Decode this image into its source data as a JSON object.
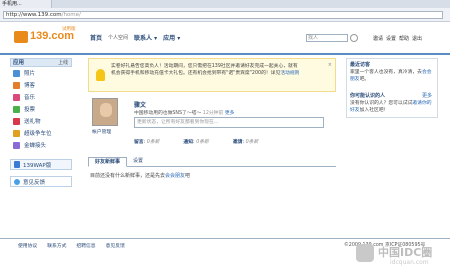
{
  "browser": {
    "tab_title": "手机用...",
    "url_host": "http://www.139.com",
    "url_path": "/home/"
  },
  "header": {
    "logo_text": "139.com",
    "trial_badge": "试用版",
    "nav": [
      {
        "label": "首页"
      },
      {
        "label": "个人空间"
      },
      {
        "label": "联系人 ▾"
      },
      {
        "label": "应用 ▾"
      }
    ],
    "search_placeholder": "找人",
    "top_links": [
      "邀请",
      "设置",
      "帮助",
      "退出"
    ]
  },
  "sidebar": {
    "title": "应用",
    "action": "上线",
    "items": [
      {
        "label": "照片",
        "icon": "photo-icon",
        "color": "#4a90d9"
      },
      {
        "label": "博客",
        "icon": "blog-icon",
        "color": "#e27d2b"
      },
      {
        "label": "音乐",
        "icon": "music-icon",
        "color": "#d94a7a"
      },
      {
        "label": "投票",
        "icon": "vote-icon",
        "color": "#4ab04a"
      },
      {
        "label": "送礼物",
        "icon": "gift-icon",
        "color": "#d9374a"
      },
      {
        "label": "超级争车位",
        "icon": "parking-icon",
        "color": "#e0a020"
      },
      {
        "label": "金蝉接头",
        "icon": "game-icon",
        "color": "#8a6ad9"
      }
    ],
    "wap_label": "139WAP版",
    "feedback_label": "意见反馈"
  },
  "notice": {
    "line1": "实卷好礼悬告您高负人！活动期间，您只需把在139社区并邀请好友完成一起关心，就有",
    "line2": "机会获得手机和移动充值卡大礼包。还有机会抢到带有\"诺\"贵宾席\"200的！详见",
    "link": "活动规则",
    "close": "×"
  },
  "profile": {
    "name": "骤文",
    "caption": "帐户管理",
    "meta_a": "中国移动用的也做SNS了～嗒～",
    "meta_b": "12分钟前",
    "meta_more": "更多",
    "status_placeholder": "更新状态，让所有好友都看到你现在...",
    "counters": [
      {
        "label": "留言",
        "value": "0条新"
      },
      {
        "label": "通知",
        "value": "0条新"
      },
      {
        "label": "邀请",
        "value": "0条新"
      }
    ]
  },
  "tabs": [
    "好友新鲜事",
    "设置"
  ],
  "feed": {
    "text": "目前还没有什么新鲜事，还是先去",
    "link": "会会朋友",
    "suffix": "吧"
  },
  "right": {
    "visitors_title": "最近访客",
    "visitors_text": "家里一个客人也没有，真冷清，去",
    "visitors_link": "会会朋友",
    "visitors_suffix": "吧。",
    "maybe_title": "你可能认识的人",
    "maybe_more": "更多",
    "maybe_text": "没有你认识的人？您可以试试",
    "maybe_link": "邀请你的好友",
    "maybe_suffix": "加入社区吧！"
  },
  "footer": {
    "links": [
      "使用协议",
      "联系方式",
      "招聘信息",
      "意见反馈"
    ],
    "copyright": "©2009 139.com 京ICP证080595号"
  },
  "watermark": {
    "title": "中国IDC圈",
    "sub": "idcquan.com"
  }
}
